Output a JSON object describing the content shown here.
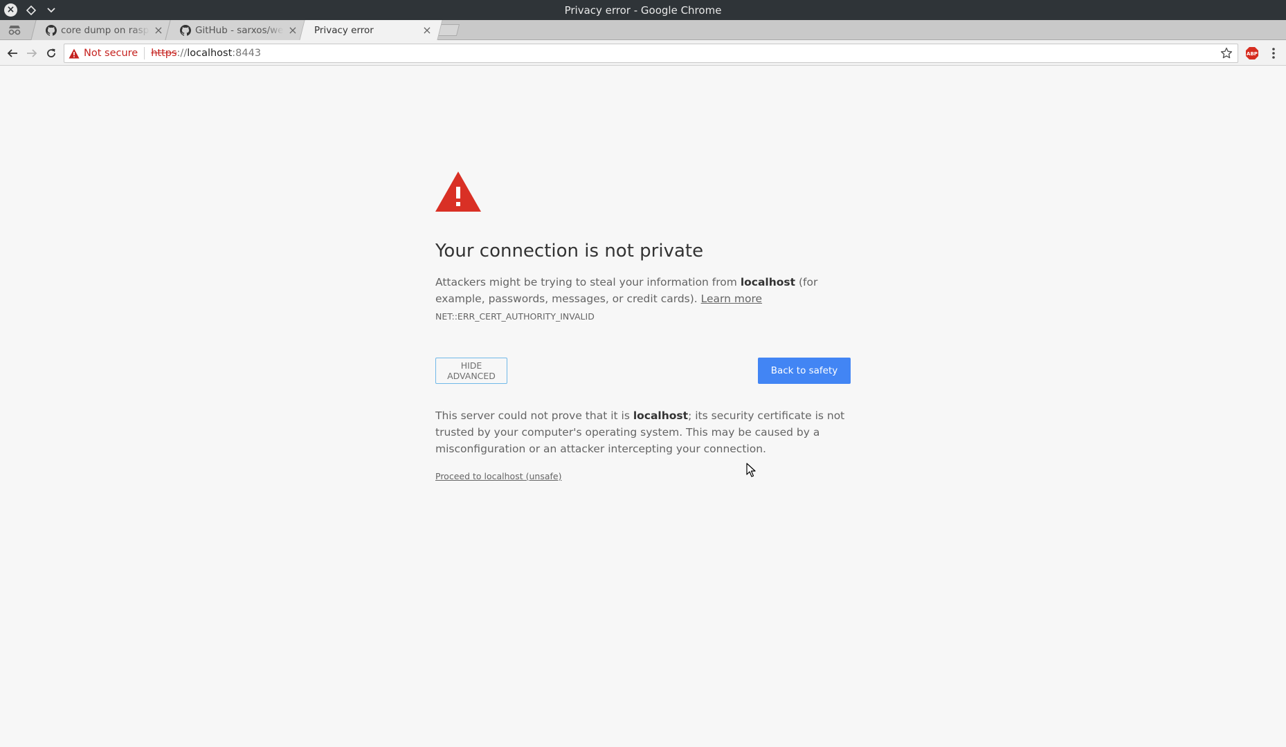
{
  "window": {
    "title": "Privacy error - Google Chrome"
  },
  "tabs": [
    {
      "label": "core dump on raspbe",
      "icon": "github-icon",
      "active": false
    },
    {
      "label": "GitHub - sarxos/webc",
      "icon": "github-icon",
      "active": false
    },
    {
      "label": "Privacy error",
      "icon": "",
      "active": true
    }
  ],
  "toolbar": {
    "security_label": "Not secure",
    "url_scheme": "https",
    "url_scheme_sep": "://",
    "url_host": "localhost",
    "url_port": ":8443"
  },
  "page": {
    "heading": "Your connection is not private",
    "explanation_before": "Attackers might be trying to steal your information from ",
    "explanation_host": "localhost",
    "explanation_after": " (for example, passwords, messages, or credit cards). ",
    "learn_more": "Learn more",
    "error_code": "NET::ERR_CERT_AUTHORITY_INVALID",
    "hide_advanced": "HIDE ADVANCED",
    "back_to_safety": "Back to safety",
    "details_before": "This server could not prove that it is ",
    "details_host": "localhost",
    "details_after": "; its security certificate is not trusted by your computer's operating system. This may be caused by a misconfiguration or an attacker intercepting your connection.",
    "proceed_link": "Proceed to localhost (unsafe)"
  },
  "colors": {
    "warning_red": "#d93025",
    "primary_blue": "#4285f4",
    "not_secure_red": "#c5221f"
  },
  "icons": [
    "close-icon",
    "diamond-icon",
    "chevron-down-icon",
    "incognito-icon",
    "github-icon",
    "back-arrow-icon",
    "forward-arrow-icon",
    "reload-icon",
    "warning-icon",
    "star-icon",
    "adblock-icon",
    "more-vert-icon",
    "warning-triangle-icon",
    "mouse-cursor-icon"
  ]
}
